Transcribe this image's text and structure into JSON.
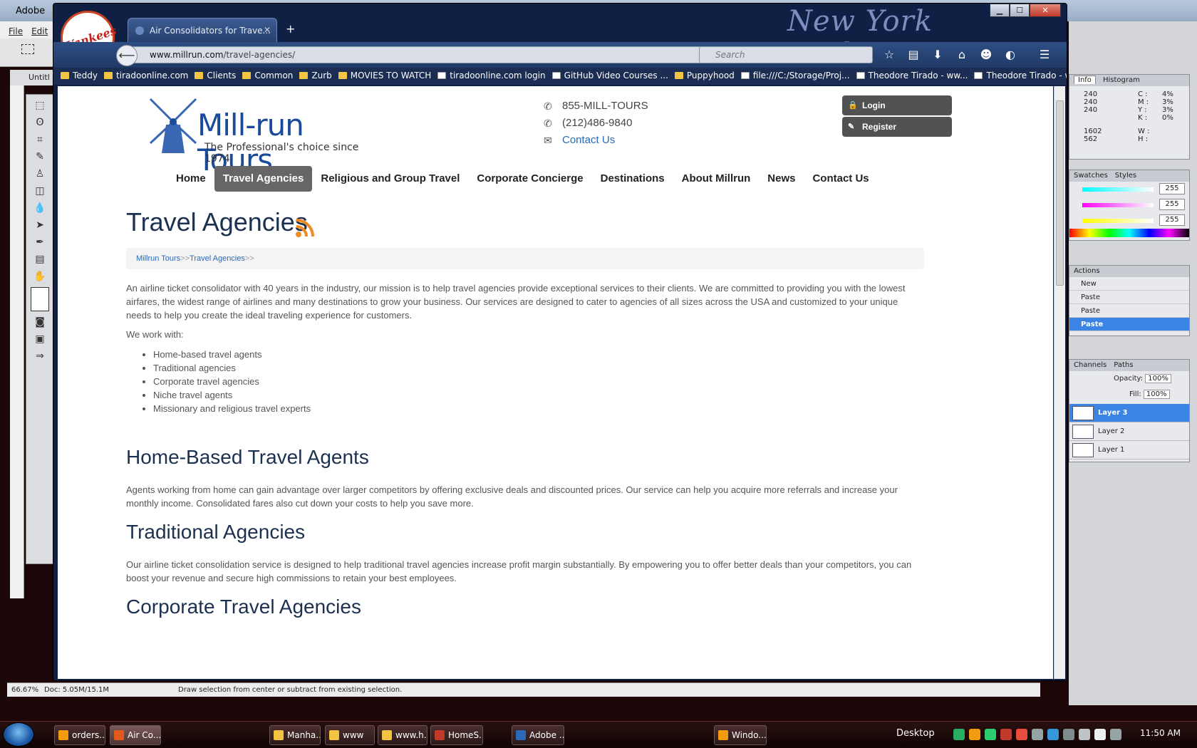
{
  "photoshop": {
    "title": "Adobe",
    "menu": [
      "File",
      "Edit"
    ],
    "doc_tab": "Untitl",
    "zoom": "66.67%",
    "doc_size": "Doc: 5.05M/15.1M",
    "status_hint": "Draw selection from center or subtract from existing selection.",
    "info_tabs": [
      "Info",
      "Histogram"
    ],
    "info_values": {
      "c": "C :",
      "c_val": "4%",
      "m": "M :",
      "m_val": "3%",
      "y": "Y :",
      "y_val": "3%",
      "k": "K :",
      "k_val": "0%",
      "r": "240",
      "g": "240",
      "b": "240",
      "x": "1602",
      "y2": "562",
      "w": "W :",
      "h": "H :"
    },
    "color_tabs": [
      "Swatches",
      "Styles"
    ],
    "color_values": [
      "255",
      "255",
      "255"
    ],
    "history_tabs": [
      "Actions"
    ],
    "history_items": [
      "New",
      "Paste",
      "Paste",
      "Paste"
    ],
    "layer_tabs": [
      "Channels",
      "Paths"
    ],
    "opacity_label": "Opacity:",
    "opacity": "100%",
    "fill_label": "Fill:",
    "fill": "100%",
    "layers": [
      "Layer 3",
      "Layer 2",
      "Layer 1"
    ]
  },
  "browser": {
    "brand": "New York Yankees™",
    "logo_text": "Yankees",
    "tab_title": "Air Consolidators for Trave...",
    "url_domain": "www.millrun.com",
    "url_path": "/travel-agencies/",
    "search_placeholder": "Search",
    "bookmarks": [
      {
        "label": "Teddy",
        "type": "folder"
      },
      {
        "label": "tiradoonline.com",
        "type": "folder"
      },
      {
        "label": "Clients",
        "type": "folder"
      },
      {
        "label": "Common",
        "type": "folder"
      },
      {
        "label": "Zurb",
        "type": "folder"
      },
      {
        "label": "MOVIES TO WATCH",
        "type": "folder"
      },
      {
        "label": "tiradoonline.com login",
        "type": "page"
      },
      {
        "label": "GitHub Video Courses ...",
        "type": "page"
      },
      {
        "label": "Puppyhood",
        "type": "folder"
      },
      {
        "label": "file:///C:/Storage/Proj...",
        "type": "page"
      },
      {
        "label": "Theodore Tirado - ww...",
        "type": "page"
      },
      {
        "label": "Theodore Tirado - ww...",
        "type": "page"
      }
    ]
  },
  "site": {
    "logo_title": "Mill-run Tours",
    "logo_sub": "The Professional's choice since 1974",
    "phone1": "855-MILL-TOURS",
    "phone2": "(212)486-9840",
    "contact_link": "Contact Us",
    "login": "Login",
    "register": "Register",
    "nav": [
      "Home",
      "Travel Agencies",
      "Religious and Group Travel",
      "Corporate Concierge",
      "Destinations",
      "About Millrun",
      "News",
      "Contact Us"
    ],
    "nav_active": "Travel Agencies",
    "page_title": "Travel Agencies",
    "breadcrumb": {
      "home": "Millrun Tours",
      "sep": ">>",
      "current": "Travel Agencies",
      "end": ">>"
    },
    "intro": "An airline ticket consolidator with 40 years in the industry, our mission is to help travel agencies provide exceptional services to their clients. We are committed to providing you with the lowest airfares, the widest range of airlines and many destinations to grow your business. Our services are designed to cater to agencies of all sizes across the USA and customized to your unique needs to help you create the ideal traveling experience for customers.",
    "work_with_label": "We work with:",
    "work_with": [
      "Home-based travel agents",
      "Traditional agencies",
      "Corporate travel agencies",
      "Niche travel agents",
      "Missionary and religious travel experts"
    ],
    "sections": [
      {
        "heading": "Home-Based Travel Agents",
        "text": "Agents working from home can gain advantage over larger competitors by offering exclusive deals and discounted prices. Our service can help you acquire more referrals and increase your monthly income. Consolidated fares also cut down your costs to help you save more."
      },
      {
        "heading": "Traditional Agencies",
        "text": "Our airline ticket consolidation service is designed to help traditional travel agencies increase profit margin substantially. By empowering you to offer better deals than your competitors, you can boost your revenue and secure high commissions to retain your best employees."
      },
      {
        "heading": "Corporate Travel Agencies",
        "text": ""
      }
    ]
  },
  "taskbar": {
    "items": [
      "orders...",
      "Air Co...",
      "Manha...",
      "www",
      "www.h...",
      "HomeS...",
      "Adobe ...",
      "Windo..."
    ],
    "desktop": "Desktop",
    "clock": "11:50 AM"
  },
  "colors": {
    "accent": "#1c3150",
    "link": "#2a6ab8",
    "nav_active": "#666666",
    "firefox_chrome": "#0f2044"
  }
}
